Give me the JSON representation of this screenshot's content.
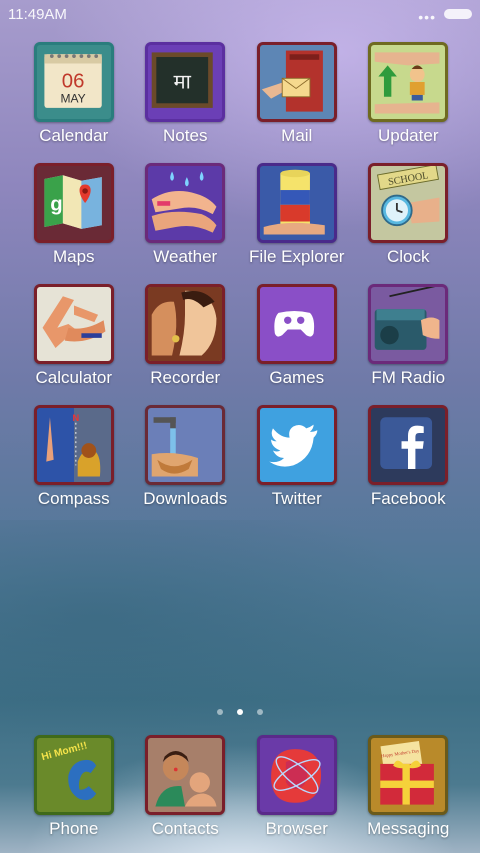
{
  "status": {
    "time": "11:49AM"
  },
  "apps": [
    {
      "label": "Calendar",
      "icon": "calendar-icon",
      "cal_day": "06",
      "cal_month": "MAY"
    },
    {
      "label": "Notes",
      "icon": "notes-icon",
      "note_text": "मा"
    },
    {
      "label": "Mail",
      "icon": "mail-icon"
    },
    {
      "label": "Updater",
      "icon": "updater-icon"
    },
    {
      "label": "Maps",
      "icon": "maps-icon"
    },
    {
      "label": "Weather",
      "icon": "weather-icon"
    },
    {
      "label": "File Explorer",
      "icon": "file-explorer-icon"
    },
    {
      "label": "Clock",
      "icon": "clock-icon",
      "sign_text": "SCHOOL"
    },
    {
      "label": "Calculator",
      "icon": "calculator-icon"
    },
    {
      "label": "Recorder",
      "icon": "recorder-icon"
    },
    {
      "label": "Games",
      "icon": "games-icon"
    },
    {
      "label": "FM Radio",
      "icon": "fm-radio-icon"
    },
    {
      "label": "Compass",
      "icon": "compass-icon",
      "compass_n": "N"
    },
    {
      "label": "Downloads",
      "icon": "downloads-icon"
    },
    {
      "label": "Twitter",
      "icon": "twitter-icon"
    },
    {
      "label": "Facebook",
      "icon": "facebook-icon"
    }
  ],
  "pager": {
    "count": 3,
    "active": 1
  },
  "dock": [
    {
      "label": "Phone",
      "icon": "phone-icon",
      "phone_text": "Hi Mom!!!"
    },
    {
      "label": "Contacts",
      "icon": "contacts-icon"
    },
    {
      "label": "Browser",
      "icon": "browser-icon"
    },
    {
      "label": "Messaging",
      "icon": "messaging-icon",
      "card_text": "Happy Mother's Day"
    }
  ],
  "colors": {
    "frame": "#7a1f2a",
    "games_bg": "#8a4fc7",
    "twitter_bg": "#3fa1e0",
    "facebook_bg": "#2d3a5c"
  }
}
